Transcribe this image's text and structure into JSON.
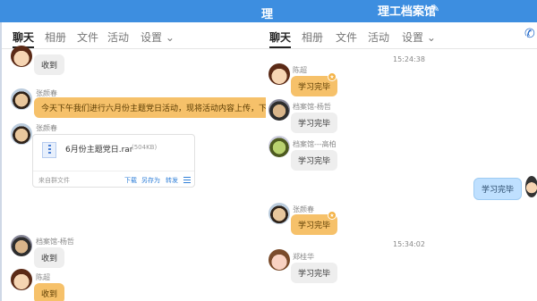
{
  "window": {
    "left_title": "理",
    "right_title": "理工档案馆"
  },
  "left_panel": {
    "tabs": [
      "聊天",
      "相册",
      "文件",
      "活动",
      "设置 ⌄"
    ],
    "messages": {
      "m1_text": "收到",
      "m2_sender": "张颜春",
      "m2_text": "今天下午我们进行六月份主题党日活动，现将活动内容上传，下午大家",
      "m3_sender": "张颜春",
      "m3_file_name": "6月份主题党日.rar",
      "m3_file_size": "(504KB)",
      "m3_file_source": "来自群文件",
      "m3_action_download": "下载",
      "m3_action_saveas": "另存为",
      "m3_action_forward": "转发",
      "m4_sender": "档案馆-杨哲",
      "m4_text": "收到",
      "m5_sender": "陈超",
      "m5_text": "收到"
    }
  },
  "right_panel": {
    "tabs": [
      "聊天",
      "相册",
      "文件",
      "活动",
      "设置 ⌄"
    ],
    "messages": {
      "time1": "15:24:38",
      "r1_sender": "陈超",
      "r1_text": "学习完毕",
      "r2_sender": "档案馆-杨哲",
      "r2_text": "学习完毕",
      "r3_sender": "档案馆---高柏",
      "r3_text": "学习完毕",
      "r4_text": "学习完毕",
      "r5_sender": "张颜春",
      "r5_text": "学习完毕",
      "time2": "15:34:02",
      "r6_sender": "郑桂华",
      "r6_text": "学习完毕"
    }
  }
}
